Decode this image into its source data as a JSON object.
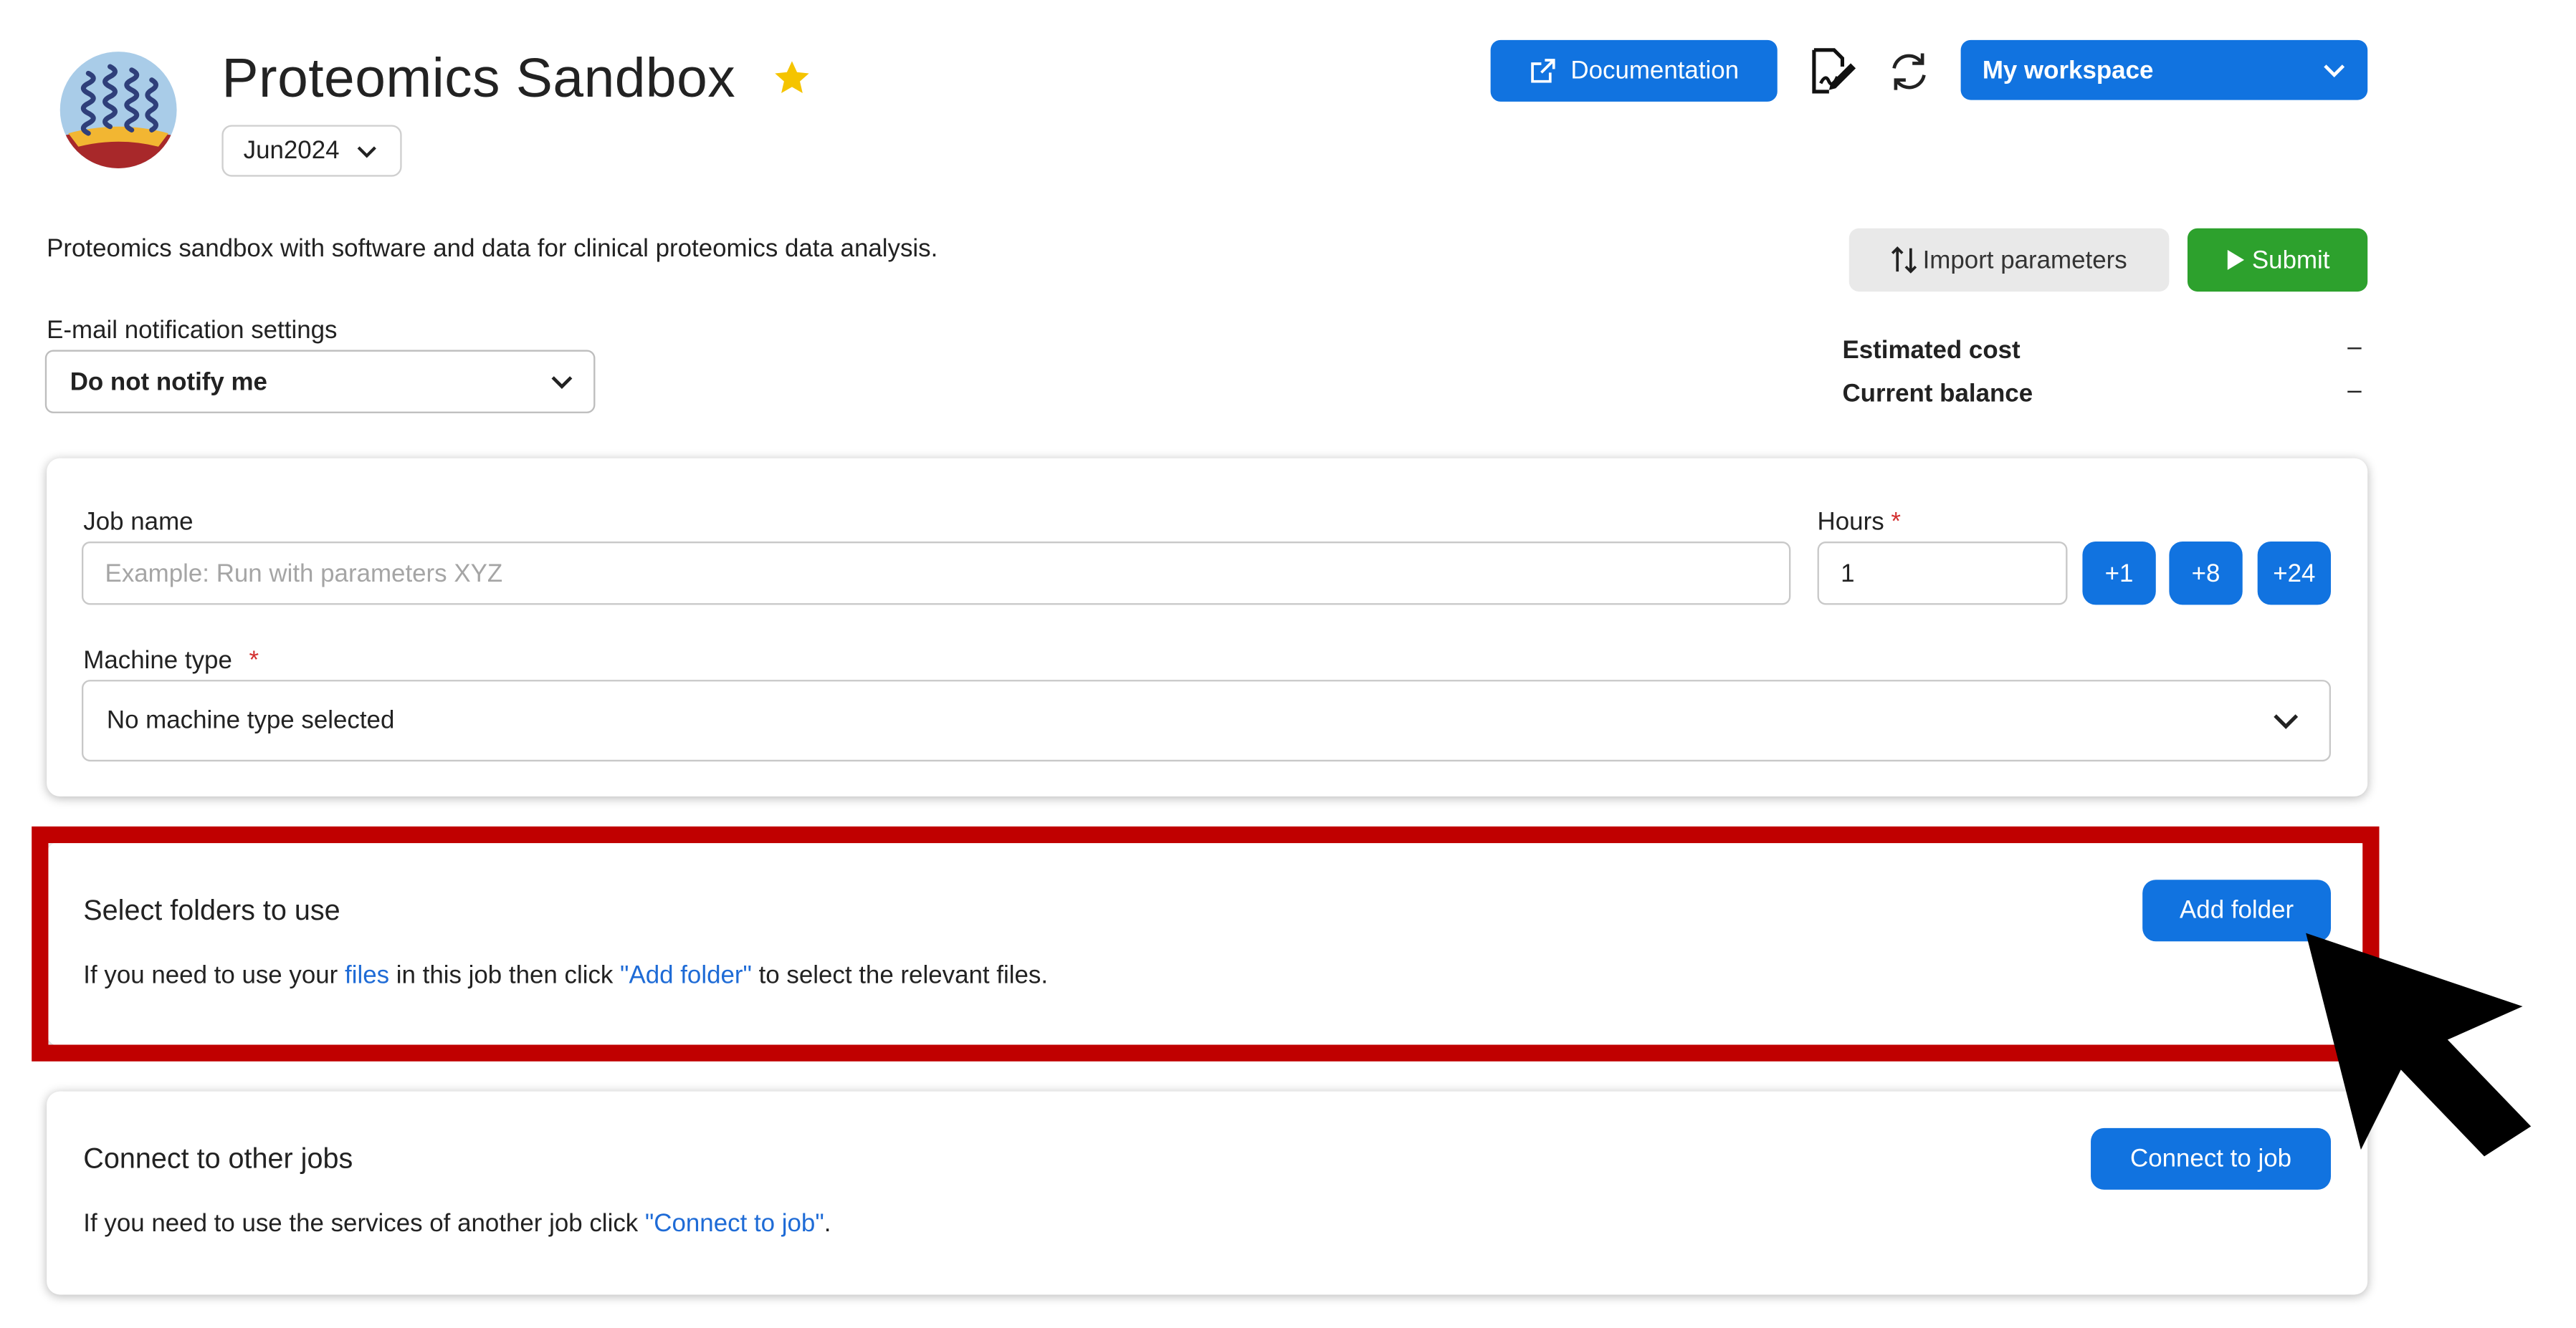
{
  "header": {
    "title": "Proteomics Sandbox",
    "version": "Jun2024",
    "documentation_label": "Documentation",
    "workspace_label": "My workspace",
    "star_color": "#f5c400"
  },
  "description": "Proteomics sandbox with software and data for clinical proteomics data analysis.",
  "actions": {
    "import_label": "Import parameters",
    "submit_label": "Submit",
    "submit_color": "#2da12d",
    "primary_color": "#1173e0"
  },
  "notifications": {
    "label": "E-mail notification settings",
    "selected": "Do not notify me"
  },
  "cost": {
    "estimated_label": "Estimated cost",
    "estimated_value": "–",
    "balance_label": "Current balance",
    "balance_value": "–"
  },
  "job_form": {
    "job_name_label": "Job name",
    "job_name_placeholder": "Example: Run with parameters XYZ",
    "hours_label": "Hours",
    "hours_required": "*",
    "hours_value": "1",
    "hour_increments": [
      "+1",
      "+8",
      "+24"
    ],
    "machine_type_label": "Machine type",
    "machine_type_required": "*",
    "machine_type_selected": "No machine type selected"
  },
  "folders": {
    "title": "Select folders to use",
    "text_before": "If you need to use your ",
    "files_link": "files",
    "text_middle": " in this job then click ",
    "add_folder_link": "\"Add folder\"",
    "text_after": " to select the relevant files.",
    "button_label": "Add folder",
    "highlight_color": "#c00000"
  },
  "connect": {
    "title": "Connect to other jobs",
    "text_before": "If you need to use the services of another job click ",
    "link": "\"Connect to job\"",
    "text_after": ".",
    "button_label": "Connect to job"
  }
}
